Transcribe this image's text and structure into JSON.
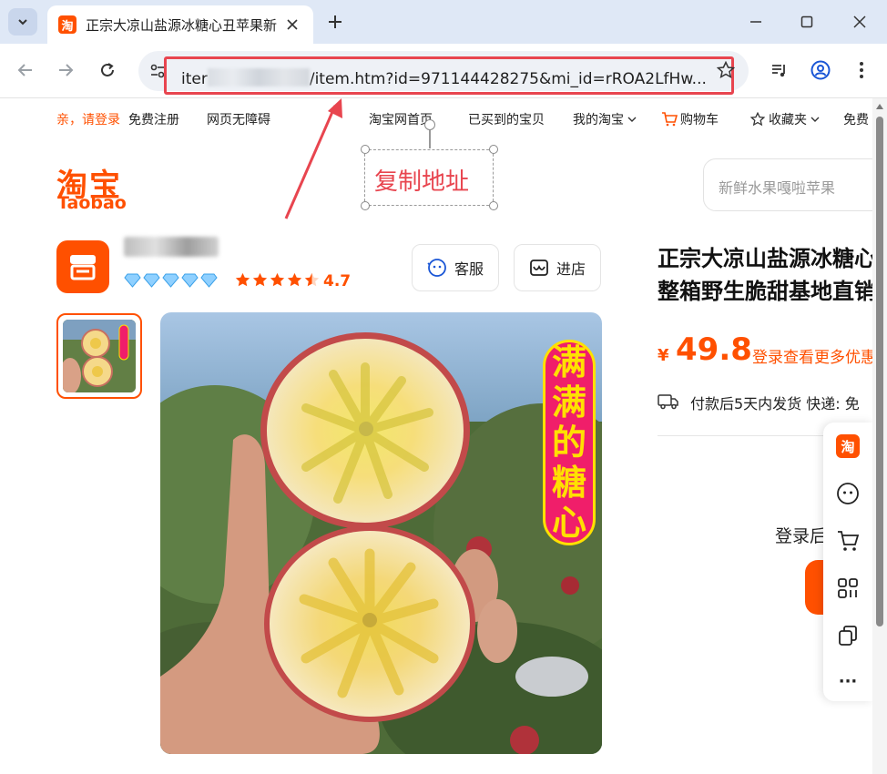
{
  "browser": {
    "tab_title": "正宗大凉山盐源冰糖心丑苹果新",
    "tab_favicon": "淘",
    "url_prefix": "iter",
    "url_rest": "/item.htm?id=971144428275&mi_id=rROA2LfHw...",
    "icons": [
      "tab-list-chevron-icon",
      "close-icon",
      "plus-icon",
      "minimize-icon",
      "maximize-icon",
      "window-close-icon",
      "back-arrow-icon",
      "forward-arrow-icon",
      "reload-icon",
      "site-info-icon",
      "bookmark-star-icon",
      "media-icon",
      "profile-icon",
      "menu-dots-icon"
    ]
  },
  "site_nav": {
    "login": "亲，请登录",
    "register": "免费注册",
    "accessibility": "网页无障碍",
    "home": "淘宝网首页",
    "bought": "已买到的宝贝",
    "my_taobao": "我的淘宝",
    "cart": "购物车",
    "favorites": "收藏夹",
    "free": "免费"
  },
  "logo": {
    "cn": "淘宝",
    "en": "Taobao"
  },
  "annotation": {
    "text": "复制地址",
    "color": "#e8454f"
  },
  "search": {
    "placeholder": "新鲜水果嘎啦苹果"
  },
  "shop": {
    "rating": "4.7",
    "service_label": "客服",
    "enter_label": "进店",
    "diamond_count": 5,
    "star_level": 4.5
  },
  "product": {
    "title_line1": "正宗大凉山盐源冰糖心",
    "title_line2": "整箱野生脆甜基地直销",
    "currency": "¥",
    "price": "49.8",
    "price_login": "登录查看更多优惠",
    "shipping": "付款后5天内发货   快递: 免",
    "login_after": "登录后",
    "badge_chars": [
      "满",
      "满",
      "的",
      "糖",
      "心"
    ]
  },
  "colors": {
    "brand": "#ff5000",
    "badge_bg": "#f01e6a",
    "badge_fg": "#ffe000",
    "url_highlight": "#e8454f"
  },
  "float_bar": {
    "icons": [
      "taobao-icon",
      "service-face-icon",
      "cart-icon",
      "apps-grid-icon",
      "copy-icon",
      "more-icon"
    ],
    "more_label": "···",
    "logo_label": "淘"
  }
}
